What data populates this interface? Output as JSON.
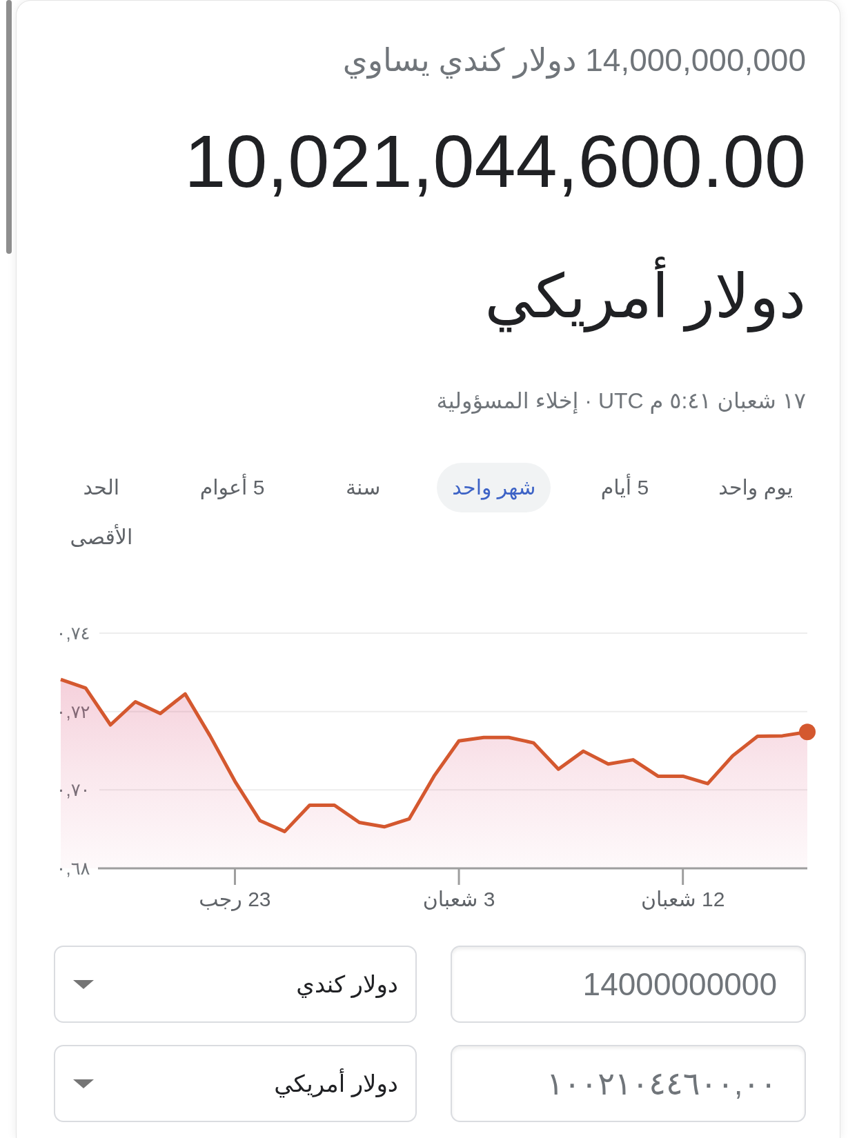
{
  "conversion": {
    "summary": "14,000,000,000 دولار كندي يساوي",
    "result_amount": "10,021,044,600.00",
    "result_currency": "دولار أمريكي",
    "timestamp": "١٧ شعبان ٥:٤١ م UTC",
    "separator": "·",
    "disclaimer_link": "إخلاء المسؤولية"
  },
  "range_tabs": [
    {
      "label": "يوم واحد",
      "selected": false
    },
    {
      "label": "5 أيام",
      "selected": false
    },
    {
      "label": "شهر واحد",
      "selected": true
    },
    {
      "label": "سنة",
      "selected": false
    },
    {
      "label": "5 أعوام",
      "selected": false
    },
    {
      "label": "الحد الأقصى",
      "selected": false
    }
  ],
  "chart": {
    "chart_data": {
      "type": "area",
      "categories": [
        null,
        null,
        null,
        null,
        null,
        null,
        null,
        "23 رجب",
        null,
        null,
        null,
        null,
        null,
        null,
        null,
        null,
        "3 شعبان",
        null,
        null,
        null,
        null,
        null,
        null,
        null,
        null,
        "12 شعبان",
        null,
        null,
        null,
        null,
        null
      ],
      "values": [
        0.7282,
        0.726,
        0.7166,
        0.7225,
        0.7195,
        0.7245,
        0.7138,
        0.7022,
        0.6922,
        0.6894,
        0.6961,
        0.6961,
        0.6917,
        0.6906,
        0.6926,
        0.7035,
        0.7125,
        0.7134,
        0.7134,
        0.712,
        0.7053,
        0.7099,
        0.7066,
        0.7077,
        0.7035,
        0.7035,
        0.7016,
        0.7087,
        0.7137,
        0.7138,
        0.7148
      ],
      "ylim": [
        0.68,
        0.74
      ],
      "yticks": [
        {
          "value": 0.68,
          "label": "٠,٦٨"
        },
        {
          "value": 0.7,
          "label": "٠,٧٠"
        },
        {
          "value": 0.72,
          "label": "٠,٧٢"
        },
        {
          "value": 0.74,
          "label": "٠,٧٤"
        }
      ]
    }
  },
  "converter": {
    "rows": [
      {
        "amount": "14000000000",
        "currency": "دولار كندي"
      },
      {
        "amount": "١٠٠٢١٠٤٤٦٠٠,٠٠",
        "currency": "دولار أمريكي"
      }
    ]
  }
}
